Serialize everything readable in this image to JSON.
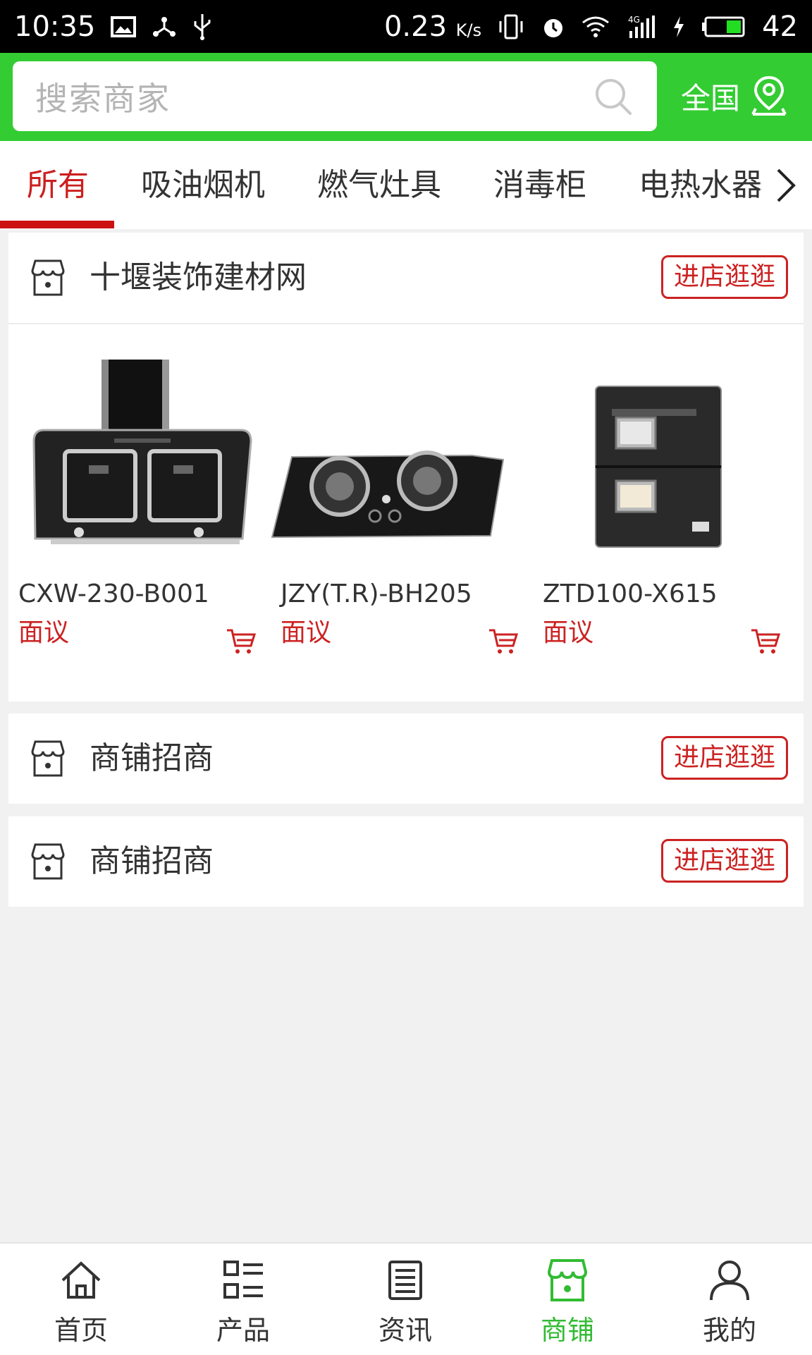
{
  "status_bar": {
    "time": "10:35",
    "speed": "0.23",
    "speed_unit": "K/s",
    "battery": "42",
    "network": "4G"
  },
  "header": {
    "search_placeholder": "搜索商家",
    "region_label": "全国",
    "bg_color": "#33cc33"
  },
  "tabs": {
    "items": [
      "所有",
      "吸油烟机",
      "燃气灶具",
      "消毒柜",
      "电热水器"
    ],
    "active_index": 0,
    "active_color": "#cc1f1f"
  },
  "shops": [
    {
      "name": "十堰装饰建材网",
      "enter_label": "进店逛逛",
      "products": [
        {
          "name": "CXW-230-B001",
          "price": "面议",
          "image": "range-hood"
        },
        {
          "name": "JZY(T.R)-BH205",
          "price": "面议",
          "image": "gas-stove"
        },
        {
          "name": "ZTD100-X615",
          "price": "面议",
          "image": "disinfection-cabinet"
        }
      ]
    },
    {
      "name": "商铺招商",
      "enter_label": "进店逛逛"
    },
    {
      "name": "商铺招商",
      "enter_label": "进店逛逛"
    }
  ],
  "bottom_nav": {
    "items": [
      {
        "label": "首页",
        "icon": "home-icon"
      },
      {
        "label": "产品",
        "icon": "grid-list-icon"
      },
      {
        "label": "资讯",
        "icon": "news-icon"
      },
      {
        "label": "商铺",
        "icon": "shop-icon"
      },
      {
        "label": "我的",
        "icon": "user-icon"
      }
    ],
    "active_index": 3,
    "active_color": "#33bb33"
  }
}
